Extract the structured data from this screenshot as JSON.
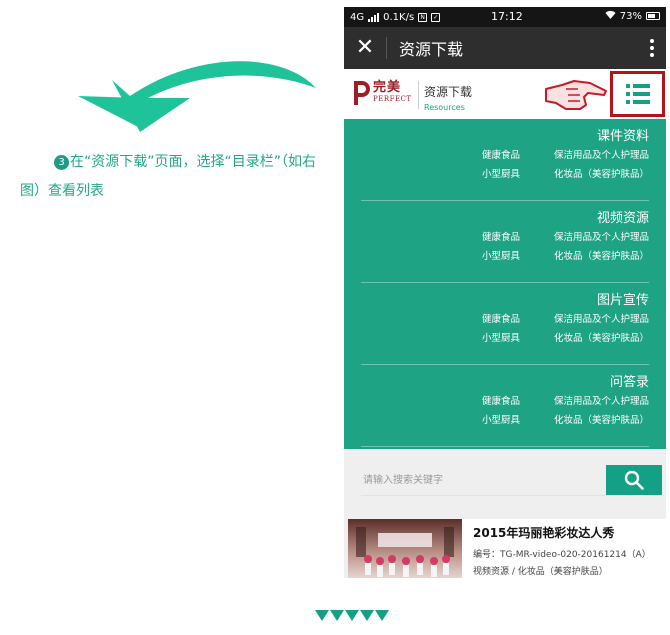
{
  "instruction": {
    "step_number": "3",
    "text": "在“资源下载”页面，选择“目录栏”（如右图）查看列表"
  },
  "phone": {
    "status_bar": {
      "network": "4G",
      "speed": "0.1K/s",
      "time": "17:12",
      "battery": "73%"
    },
    "title_bar": {
      "close_icon": "close-icon",
      "title": "资源下载",
      "more_icon": "more-vertical-icon"
    },
    "site_header": {
      "logo_cn": "完美",
      "logo_en": "PERFECT",
      "title": "资源下载",
      "subtitle": "Resources",
      "pointer_icon": "pointing-hand-icon",
      "menu_icon": "list-menu-icon"
    },
    "categories": [
      {
        "title": "课件资料",
        "items": [
          "健康食品",
          "保洁用品及个人护理品",
          "小型厨具",
          "化妆品（美容护肤品）"
        ]
      },
      {
        "title": "视频资源",
        "items": [
          "健康食品",
          "保洁用品及个人护理品",
          "小型厨具",
          "化妆品（美容护肤品）"
        ]
      },
      {
        "title": "图片宣传",
        "items": [
          "健康食品",
          "保洁用品及个人护理品",
          "小型厨具",
          "化妆品（美容护肤品）"
        ]
      },
      {
        "title": "问答录",
        "items": [
          "健康食品",
          "保洁用品及个人护理品",
          "小型厨具",
          "化妆品（美容护肤品）"
        ]
      }
    ],
    "search": {
      "placeholder": "请输入搜索关键字",
      "button_icon": "search-icon"
    },
    "result": {
      "title": "2015年玛丽艳彩妆达人秀",
      "code": "编号：TG-MR-video-020-20161214（A）",
      "path": "视频资源 / 化妆品（美容护肤品）"
    }
  },
  "colors": {
    "brand_green": "#1ea384",
    "brand_red": "#b1141b",
    "title_bar": "#2e2e2e"
  }
}
